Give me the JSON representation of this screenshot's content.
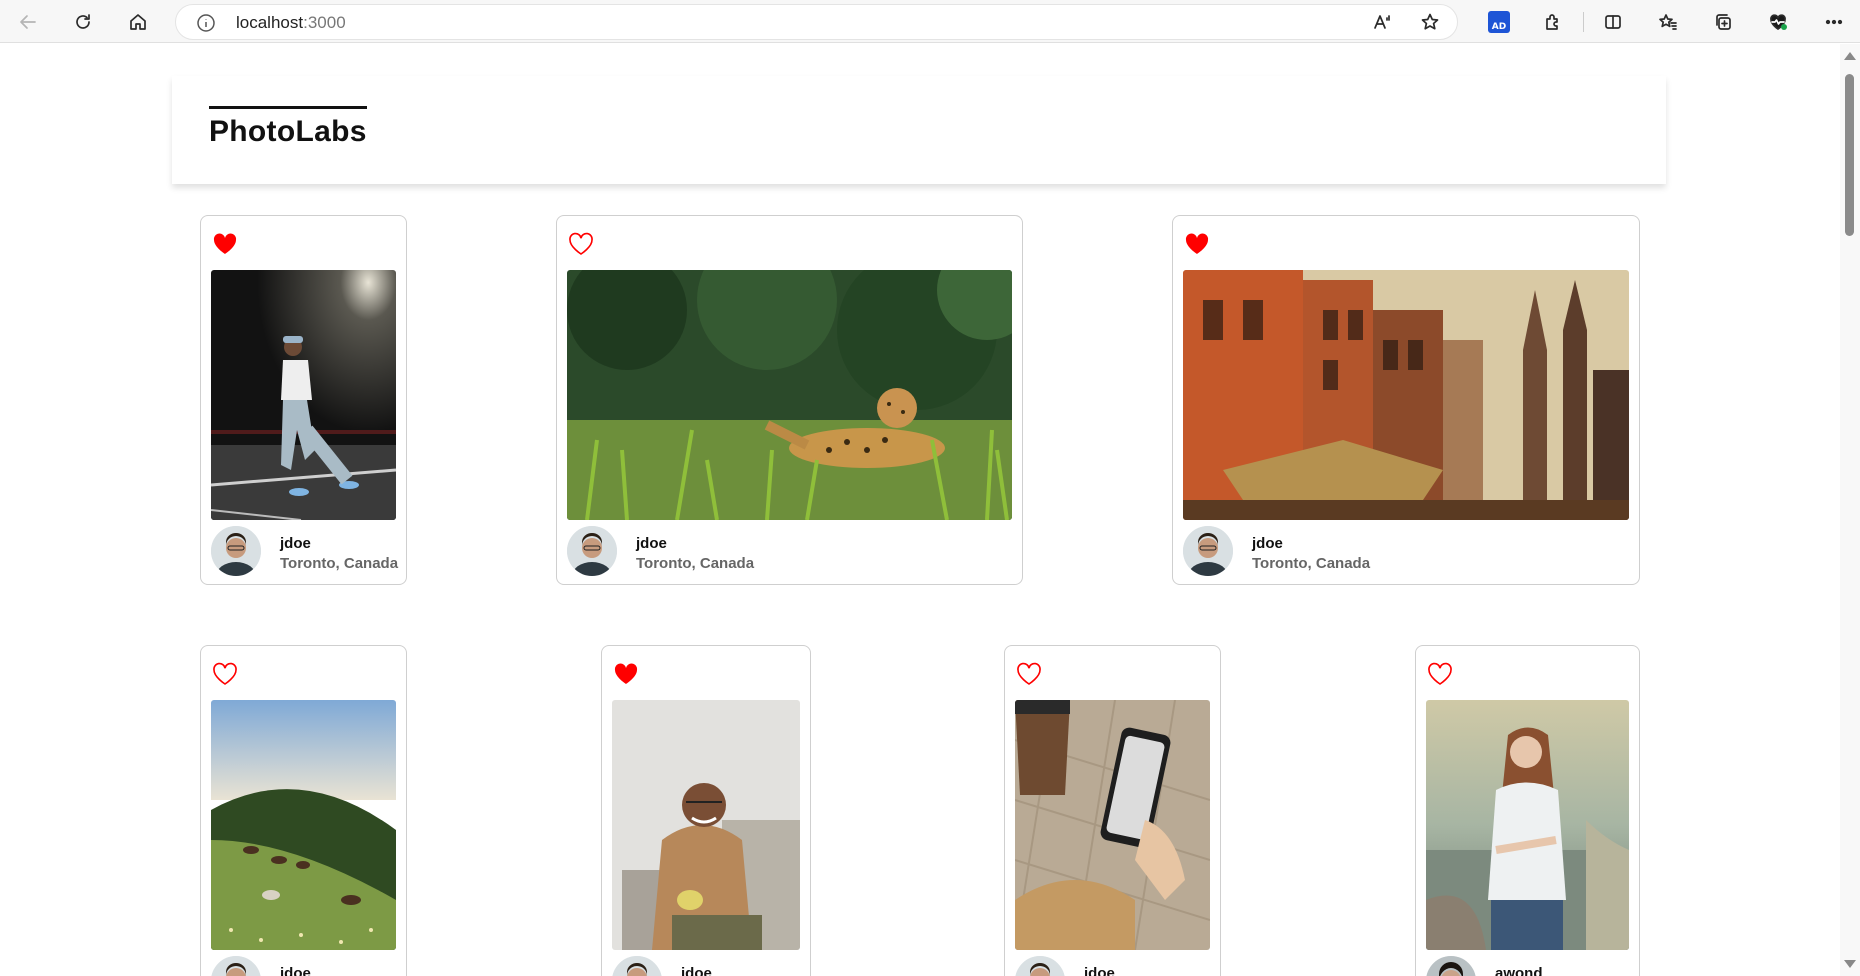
{
  "browser": {
    "url_host": "localhost",
    "url_port": ":3000",
    "icons": [
      "back-arrow-icon",
      "refresh-icon",
      "home-icon",
      "site-info-icon",
      "read-aloud-icon",
      "favorite-star-icon",
      "extension-ad-icon",
      "extensions-puzzle-icon",
      "split-screen-icon",
      "favorites-icon",
      "collections-icon",
      "browser-health-icon",
      "more-menu-icon"
    ]
  },
  "app": {
    "logo": "PhotoLabs"
  },
  "colors": {
    "heart": "#ff0000",
    "text": "#111111",
    "subtext": "#666666"
  },
  "photos": [
    {
      "favorited": true,
      "subject": "man-walking-night",
      "username": "jdoe",
      "location": "Toronto, Canada"
    },
    {
      "favorited": false,
      "subject": "jaguar-in-grass",
      "username": "jdoe",
      "location": "Toronto, Canada"
    },
    {
      "favorited": true,
      "subject": "old-town-buildings",
      "username": "jdoe",
      "location": "Toronto, Canada"
    },
    {
      "favorited": false,
      "subject": "horses-on-hillside",
      "username": "jdoe",
      "location": ""
    },
    {
      "favorited": true,
      "subject": "man-with-mug",
      "username": "jdoe",
      "location": ""
    },
    {
      "favorited": false,
      "subject": "coffee-and-phone",
      "username": "jdoe",
      "location": ""
    },
    {
      "favorited": false,
      "subject": "woman-by-lake",
      "username": "awond",
      "location": ""
    }
  ]
}
